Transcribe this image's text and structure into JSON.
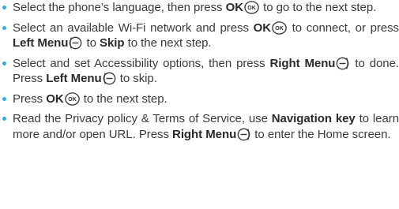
{
  "steps": [
    {
      "parts": [
        {
          "t": "Select the phone’s language, then press "
        },
        {
          "b": "OK"
        },
        {
          "i": "ok"
        },
        {
          "t": " to go to the next step."
        }
      ]
    },
    {
      "parts": [
        {
          "t": "Select an available Wi-Fi network and press "
        },
        {
          "b": "OK"
        },
        {
          "i": "ok"
        },
        {
          "t": " to connect, or press "
        },
        {
          "b": "Left Menu"
        },
        {
          "i": "left-menu"
        },
        {
          "t": " to "
        },
        {
          "b": "Skip"
        },
        {
          "t": " to the next step."
        }
      ]
    },
    {
      "parts": [
        {
          "t": "Select and set Accessibility options, then press "
        },
        {
          "b": "Right Menu"
        },
        {
          "i": "right-menu"
        },
        {
          "t": " to done. Press "
        },
        {
          "b": "Left Menu"
        },
        {
          "i": "left-menu"
        },
        {
          "t": " to skip."
        }
      ]
    },
    {
      "parts": [
        {
          "t": "Press "
        },
        {
          "b": "OK"
        },
        {
          "i": "ok"
        },
        {
          "t": " to the next step."
        }
      ]
    },
    {
      "parts": [
        {
          "t": "Read the Privacy policy & Terms of Service, use "
        },
        {
          "b": "Navigation key"
        },
        {
          "t": " to learn more and/or open URL. Press "
        },
        {
          "b": "Right Menu"
        },
        {
          "i": "right-menu"
        },
        {
          "t": " to enter the Home screen."
        }
      ]
    }
  ],
  "icons": {
    "ok": {
      "name": "ok-key-icon",
      "label": "OK"
    },
    "left-menu": {
      "name": "left-menu-key-icon"
    },
    "right-menu": {
      "name": "right-menu-key-icon"
    }
  },
  "colors": {
    "bullet": "#2bb0e3",
    "text": "#3a3a3a"
  }
}
